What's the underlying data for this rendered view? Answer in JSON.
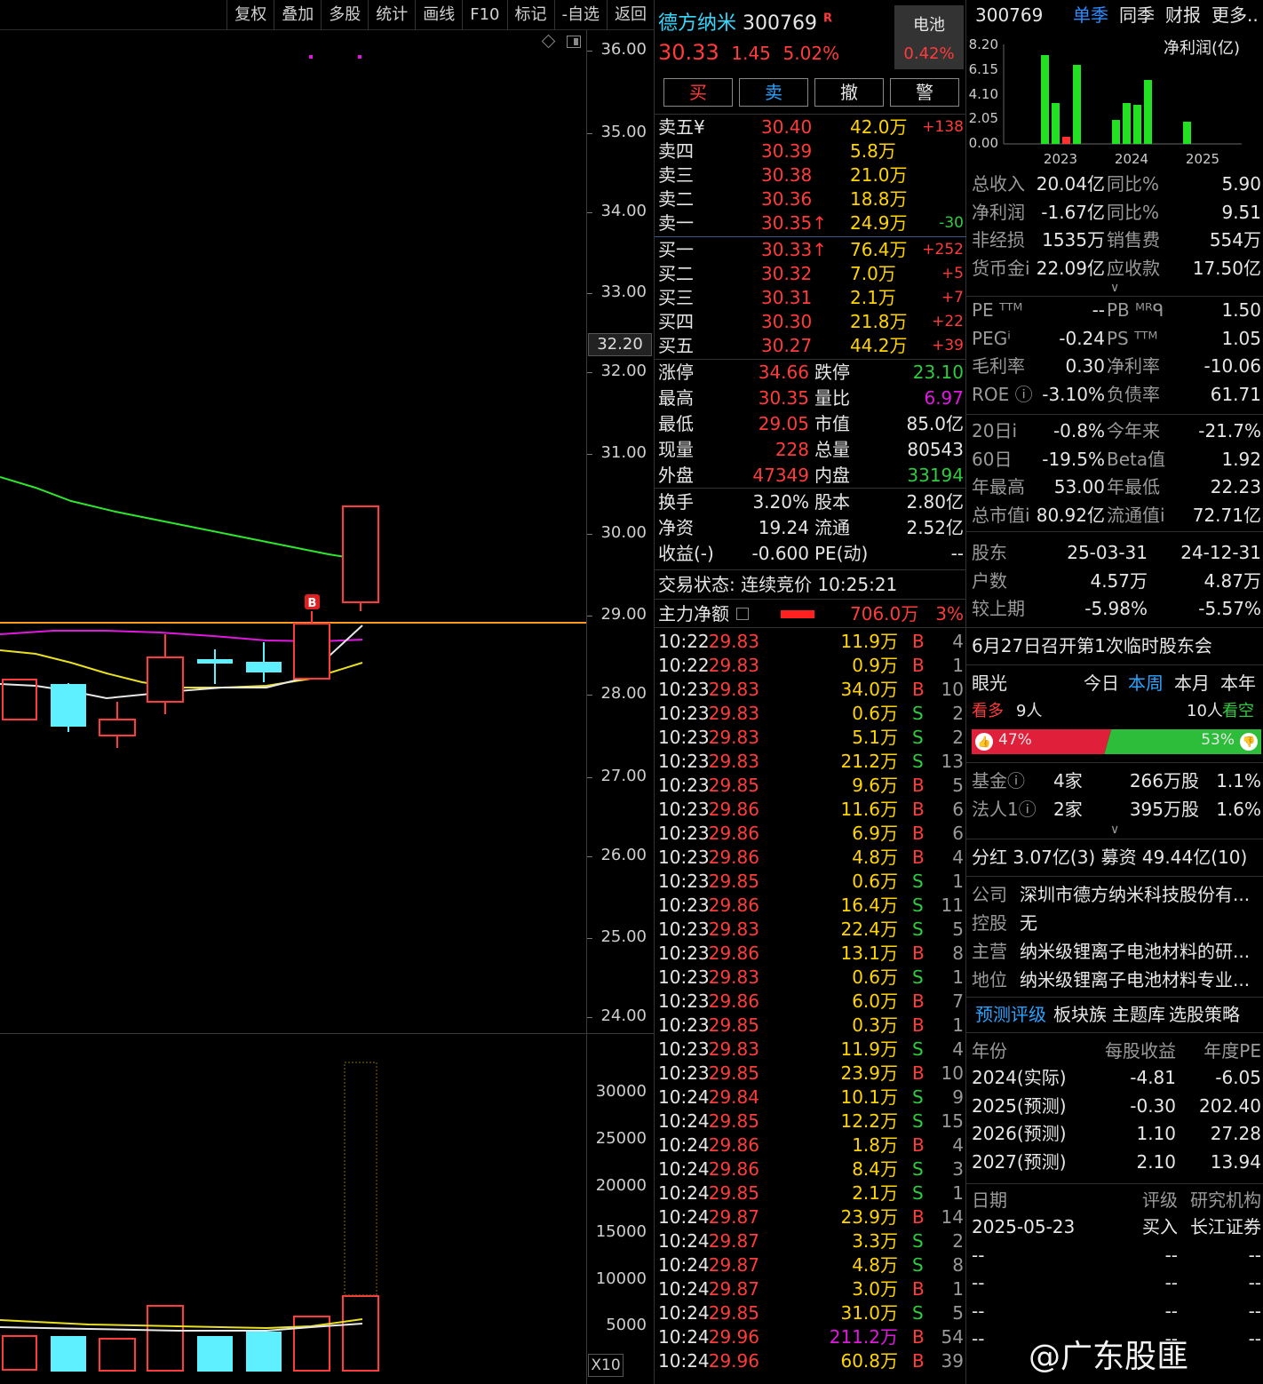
{
  "toolbar": [
    "复权",
    "叠加",
    "多股",
    "统计",
    "画线",
    "F10",
    "标记",
    "-自选",
    "返回"
  ],
  "chart": {
    "price_ticks": [
      "36.00",
      "35.00",
      "34.00",
      "33.00",
      "32.00",
      "31.00",
      "30.00",
      "29.00",
      "28.00",
      "27.00",
      "26.00",
      "25.00",
      "24.00"
    ],
    "current_price_tag": "32.20",
    "volume_ticks": [
      "30000",
      "25000",
      "20000",
      "15000",
      "10000",
      "5000"
    ],
    "volume_unit": "X10",
    "marker": "B"
  },
  "quote": {
    "name": "德方纳米",
    "code": "300769",
    "r_flag": "R",
    "price": "30.33",
    "change": "1.45",
    "change_pct": "5.02%",
    "sector": "电池",
    "sector_pct": "0.42%",
    "buttons": [
      "买",
      "卖",
      "撤",
      "警"
    ],
    "sell": [
      {
        "label": "卖五¥",
        "price": "30.40",
        "vol": "42.0万",
        "delta": "+138"
      },
      {
        "label": "卖四",
        "price": "30.39",
        "vol": "5.8万",
        "delta": ""
      },
      {
        "label": "卖三",
        "price": "30.38",
        "vol": "21.0万",
        "delta": ""
      },
      {
        "label": "卖二",
        "price": "30.36",
        "vol": "18.8万",
        "delta": ""
      },
      {
        "label": "卖一",
        "price": "30.35",
        "vol": "24.9万",
        "delta": "-30"
      }
    ],
    "buy": [
      {
        "label": "买一",
        "price": "30.33",
        "vol": "76.4万",
        "delta": "+252"
      },
      {
        "label": "买二",
        "price": "30.32",
        "vol": "7.0万",
        "delta": "+5"
      },
      {
        "label": "买三",
        "price": "30.31",
        "vol": "2.1万",
        "delta": "+7"
      },
      {
        "label": "买四",
        "price": "30.30",
        "vol": "21.8万",
        "delta": "+22"
      },
      {
        "label": "买五",
        "price": "30.27",
        "vol": "44.2万",
        "delta": "+39"
      }
    ],
    "stats1": [
      {
        "l1": "涨停",
        "v1": "34.66",
        "l2": "跌停",
        "v2": "23.10"
      },
      {
        "l1": "最高",
        "v1": "30.35",
        "l2": "量比",
        "v2": "6.97"
      },
      {
        "l1": "最低",
        "v1": "29.05",
        "l2": "市值",
        "v2": "85.0亿"
      },
      {
        "l1": "现量",
        "v1": "228",
        "l2": "总量",
        "v2": "80543"
      },
      {
        "l1": "外盘",
        "v1": "47349",
        "l2": "内盘",
        "v2": "33194"
      }
    ],
    "stats2": [
      {
        "l1": "换手",
        "v1": "3.20%",
        "l2": "股本",
        "v2": "2.80亿"
      },
      {
        "l1": "净资",
        "v1": "19.24",
        "l2": "流通",
        "v2": "2.52亿"
      },
      {
        "l1": "收益(-)",
        "v1": "-0.600",
        "l2": "PE(动)",
        "v2": "--"
      }
    ],
    "status": "交易状态: 连续竞价 10:25:21",
    "main_flow_label": "主力净额",
    "main_flow_value": "706.0万",
    "main_flow_pct": "3%",
    "ticks": [
      [
        "10:22",
        "29.83",
        "11.9万",
        "B",
        "4"
      ],
      [
        "10:22",
        "29.83",
        "0.9万",
        "B",
        "1"
      ],
      [
        "10:23",
        "29.83",
        "34.0万",
        "B",
        "10"
      ],
      [
        "10:23",
        "29.83",
        "0.6万",
        "S",
        "2"
      ],
      [
        "10:23",
        "29.83",
        "5.1万",
        "S",
        "2"
      ],
      [
        "10:23",
        "29.83",
        "21.2万",
        "S",
        "13"
      ],
      [
        "10:23",
        "29.85",
        "9.6万",
        "B",
        "5"
      ],
      [
        "10:23",
        "29.86",
        "11.6万",
        "B",
        "6"
      ],
      [
        "10:23",
        "29.86",
        "6.9万",
        "B",
        "6"
      ],
      [
        "10:23",
        "29.86",
        "4.8万",
        "B",
        "4"
      ],
      [
        "10:23",
        "29.85",
        "0.6万",
        "S",
        "1"
      ],
      [
        "10:23",
        "29.86",
        "16.4万",
        "S",
        "11"
      ],
      [
        "10:23",
        "29.83",
        "22.4万",
        "S",
        "5"
      ],
      [
        "10:23",
        "29.86",
        "13.1万",
        "B",
        "8"
      ],
      [
        "10:23",
        "29.83",
        "0.6万",
        "S",
        "1"
      ],
      [
        "10:23",
        "29.86",
        "6.0万",
        "B",
        "7"
      ],
      [
        "10:23",
        "29.85",
        "0.3万",
        "B",
        "1"
      ],
      [
        "10:23",
        "29.83",
        "11.9万",
        "S",
        "4"
      ],
      [
        "10:23",
        "29.85",
        "23.9万",
        "B",
        "10"
      ],
      [
        "10:24",
        "29.84",
        "10.1万",
        "S",
        "9"
      ],
      [
        "10:24",
        "29.85",
        "12.2万",
        "S",
        "15"
      ],
      [
        "10:24",
        "29.86",
        "1.8万",
        "B",
        "4"
      ],
      [
        "10:24",
        "29.86",
        "8.4万",
        "S",
        "3"
      ],
      [
        "10:24",
        "29.85",
        "2.1万",
        "S",
        "1"
      ],
      [
        "10:24",
        "29.87",
        "23.9万",
        "B",
        "14"
      ],
      [
        "10:24",
        "29.87",
        "3.3万",
        "S",
        "2"
      ],
      [
        "10:24",
        "29.87",
        "4.8万",
        "S",
        "8"
      ],
      [
        "10:24",
        "29.87",
        "3.0万",
        "B",
        "1"
      ],
      [
        "10:24",
        "29.85",
        "31.0万",
        "S",
        "5"
      ],
      [
        "10:24",
        "29.96",
        "211.2万",
        "B",
        "54"
      ],
      [
        "10:24",
        "29.96",
        "60.8万",
        "B",
        "39"
      ]
    ]
  },
  "f10": {
    "code": "300769",
    "tabs": [
      "单季",
      "同季",
      "财报",
      "更多.."
    ],
    "chart_title": "净利润(亿)",
    "chart_y": [
      "8.20",
      "6.15",
      "4.10",
      "2.05",
      "0.00"
    ],
    "chart_x": [
      "2023",
      "2024",
      "2025"
    ],
    "fin": [
      [
        "总收入",
        "20.04亿",
        "同比%",
        "5.90"
      ],
      [
        "净利润",
        "-1.67亿",
        "同比%",
        "9.51"
      ],
      [
        "非经损",
        "1535万",
        "销售费",
        "554万"
      ],
      [
        "货币金ⅰ",
        "22.09亿",
        "应收款",
        "17.50亿"
      ]
    ],
    "val": [
      [
        "PE ᵀᵀᴹ",
        "--",
        "PB ᴹᴿᑫ",
        "1.50"
      ],
      [
        "PEGⁱ",
        "-0.24",
        "PS ᵀᵀᴹ",
        "1.05"
      ],
      [
        "毛利率",
        "0.30",
        "净利率",
        "-10.06"
      ],
      [
        "ROE ⓘ",
        "-3.10%",
        "负债率",
        "61.71"
      ]
    ],
    "perf": [
      [
        "20日ⅰ",
        "-0.8%",
        "今年来",
        "-21.7%"
      ],
      [
        "60日",
        "-19.5%",
        "Beta值",
        "1.92"
      ],
      [
        "年最高",
        "53.00",
        "年最低",
        "22.23"
      ],
      [
        "总市值ⅰ",
        "80.92亿",
        "流通值ⅰ",
        "72.71亿"
      ]
    ],
    "holders": [
      [
        "股东",
        "25-03-31",
        "24-12-31"
      ],
      [
        "户数",
        "4.57万",
        "4.87万"
      ],
      [
        "较上期",
        "-5.98%",
        "-5.57%"
      ]
    ],
    "notice": "6月27日召开第1次临时股东会",
    "vision_label": "眼光",
    "vision_tabs": [
      "今日",
      "本周",
      "本月",
      "本年"
    ],
    "bull_label": "看多",
    "bull_count": "9人",
    "bear_count": "10人",
    "bear_label": "看空",
    "bull_pct": "47%",
    "bear_pct": "53%",
    "bull_ratio": 0.47,
    "inst": [
      [
        "基金ⓘ",
        "4家",
        "266万股",
        "1.1%"
      ],
      [
        "法人1ⓘ",
        "2家",
        "395万股",
        "1.6%"
      ]
    ],
    "dividend": "分红  3.07亿(3) 募资  49.44亿(10)",
    "company_label": "公司",
    "company": "深圳市德方纳米科技股份有...",
    "holder_label": "控股",
    "holder": "无",
    "main_label": "主营",
    "main_business": "纳米级锂离子电池材料的研...",
    "position_label": "地位",
    "position": "纳米级锂离子电池材料专业...",
    "links": [
      "预测评级",
      "板块族",
      "主题库",
      "选股策略"
    ],
    "forecast_head": [
      "年份",
      "每股收益",
      "年度PE"
    ],
    "forecast": [
      [
        "2024(实际)",
        "-4.81",
        "-6.05"
      ],
      [
        "2025(预测)",
        "-0.30",
        "202.40"
      ],
      [
        "2026(预测)",
        "1.10",
        "27.28"
      ],
      [
        "2027(预测)",
        "2.10",
        "13.94"
      ]
    ],
    "rating_head": [
      "日期",
      "评级",
      "研究机构"
    ],
    "rating": [
      [
        "2025-05-23",
        "买入",
        "长江证券"
      ],
      [
        "--",
        "--",
        "--"
      ],
      [
        "--",
        "--",
        "--"
      ],
      [
        "--",
        "--",
        "--"
      ],
      [
        "--",
        "--",
        "--"
      ]
    ],
    "watermark": "@广东股匪"
  },
  "colors": {
    "up": "#ff3b3b",
    "down": "#2ecc40",
    "cyan": "#34d9ff",
    "yellow": "#ffd400",
    "magenta": "#e018e0",
    "blue": "#2aa4ff"
  }
}
